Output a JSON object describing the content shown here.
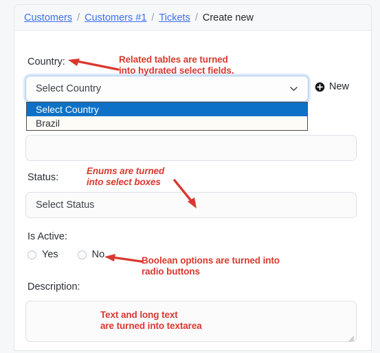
{
  "breadcrumb": {
    "items": [
      {
        "label": "Customers",
        "link": true
      },
      {
        "label": "Customers #1",
        "link": true
      },
      {
        "label": "Tickets",
        "link": true
      },
      {
        "label": "Create new",
        "link": false
      }
    ],
    "separator": "/"
  },
  "form": {
    "country": {
      "label": "Country:",
      "selected_value": "Select Country",
      "options": [
        {
          "label": "Select Country",
          "selected": true
        },
        {
          "label": "Brazil",
          "selected": false
        }
      ],
      "new_button_label": "New",
      "chevron_icon": "chevron-down-icon",
      "new_icon": "plus-circle-icon"
    },
    "hidden_field": {
      "value": "",
      "placeholder": ""
    },
    "status": {
      "label": "Status:",
      "selected_value": "Select Status"
    },
    "is_active": {
      "label": "Is Active:",
      "options": [
        {
          "label": "Yes",
          "checked": false
        },
        {
          "label": "No",
          "checked": false
        }
      ]
    },
    "description": {
      "label": "Description:",
      "value": ""
    }
  },
  "annotations": [
    {
      "id": "related-tables",
      "line1": "Related tables are turned",
      "line2": "into hydrated select fields.",
      "italic": false
    },
    {
      "id": "enums",
      "line1": "Enums are turned",
      "line2": "into select boxes",
      "italic": true
    },
    {
      "id": "boolean",
      "line1": "Boolean options are turned into",
      "line2": "radio buttons",
      "italic": false
    },
    {
      "id": "text-longtext",
      "line1": "Text and long text",
      "line2": "are turned into textarea",
      "italic": false
    }
  ],
  "colors": {
    "link": "#3b6ef0",
    "annotation": "#d9382f",
    "option_highlight": "#0d72c7",
    "focus_ring": "#a9c9f0"
  }
}
